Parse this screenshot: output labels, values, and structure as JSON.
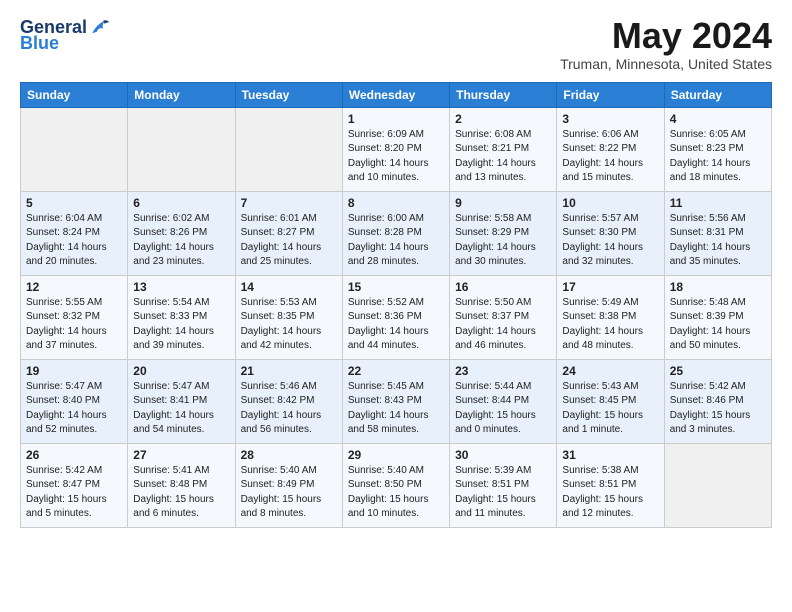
{
  "header": {
    "logo_general": "General",
    "logo_blue": "Blue",
    "month": "May 2024",
    "location": "Truman, Minnesota, United States"
  },
  "weekdays": [
    "Sunday",
    "Monday",
    "Tuesday",
    "Wednesday",
    "Thursday",
    "Friday",
    "Saturday"
  ],
  "weeks": [
    [
      {
        "day": "",
        "text": ""
      },
      {
        "day": "",
        "text": ""
      },
      {
        "day": "",
        "text": ""
      },
      {
        "day": "1",
        "text": "Sunrise: 6:09 AM\nSunset: 8:20 PM\nDaylight: 14 hours\nand 10 minutes."
      },
      {
        "day": "2",
        "text": "Sunrise: 6:08 AM\nSunset: 8:21 PM\nDaylight: 14 hours\nand 13 minutes."
      },
      {
        "day": "3",
        "text": "Sunrise: 6:06 AM\nSunset: 8:22 PM\nDaylight: 14 hours\nand 15 minutes."
      },
      {
        "day": "4",
        "text": "Sunrise: 6:05 AM\nSunset: 8:23 PM\nDaylight: 14 hours\nand 18 minutes."
      }
    ],
    [
      {
        "day": "5",
        "text": "Sunrise: 6:04 AM\nSunset: 8:24 PM\nDaylight: 14 hours\nand 20 minutes."
      },
      {
        "day": "6",
        "text": "Sunrise: 6:02 AM\nSunset: 8:26 PM\nDaylight: 14 hours\nand 23 minutes."
      },
      {
        "day": "7",
        "text": "Sunrise: 6:01 AM\nSunset: 8:27 PM\nDaylight: 14 hours\nand 25 minutes."
      },
      {
        "day": "8",
        "text": "Sunrise: 6:00 AM\nSunset: 8:28 PM\nDaylight: 14 hours\nand 28 minutes."
      },
      {
        "day": "9",
        "text": "Sunrise: 5:58 AM\nSunset: 8:29 PM\nDaylight: 14 hours\nand 30 minutes."
      },
      {
        "day": "10",
        "text": "Sunrise: 5:57 AM\nSunset: 8:30 PM\nDaylight: 14 hours\nand 32 minutes."
      },
      {
        "day": "11",
        "text": "Sunrise: 5:56 AM\nSunset: 8:31 PM\nDaylight: 14 hours\nand 35 minutes."
      }
    ],
    [
      {
        "day": "12",
        "text": "Sunrise: 5:55 AM\nSunset: 8:32 PM\nDaylight: 14 hours\nand 37 minutes."
      },
      {
        "day": "13",
        "text": "Sunrise: 5:54 AM\nSunset: 8:33 PM\nDaylight: 14 hours\nand 39 minutes."
      },
      {
        "day": "14",
        "text": "Sunrise: 5:53 AM\nSunset: 8:35 PM\nDaylight: 14 hours\nand 42 minutes."
      },
      {
        "day": "15",
        "text": "Sunrise: 5:52 AM\nSunset: 8:36 PM\nDaylight: 14 hours\nand 44 minutes."
      },
      {
        "day": "16",
        "text": "Sunrise: 5:50 AM\nSunset: 8:37 PM\nDaylight: 14 hours\nand 46 minutes."
      },
      {
        "day": "17",
        "text": "Sunrise: 5:49 AM\nSunset: 8:38 PM\nDaylight: 14 hours\nand 48 minutes."
      },
      {
        "day": "18",
        "text": "Sunrise: 5:48 AM\nSunset: 8:39 PM\nDaylight: 14 hours\nand 50 minutes."
      }
    ],
    [
      {
        "day": "19",
        "text": "Sunrise: 5:47 AM\nSunset: 8:40 PM\nDaylight: 14 hours\nand 52 minutes."
      },
      {
        "day": "20",
        "text": "Sunrise: 5:47 AM\nSunset: 8:41 PM\nDaylight: 14 hours\nand 54 minutes."
      },
      {
        "day": "21",
        "text": "Sunrise: 5:46 AM\nSunset: 8:42 PM\nDaylight: 14 hours\nand 56 minutes."
      },
      {
        "day": "22",
        "text": "Sunrise: 5:45 AM\nSunset: 8:43 PM\nDaylight: 14 hours\nand 58 minutes."
      },
      {
        "day": "23",
        "text": "Sunrise: 5:44 AM\nSunset: 8:44 PM\nDaylight: 15 hours\nand 0 minutes."
      },
      {
        "day": "24",
        "text": "Sunrise: 5:43 AM\nSunset: 8:45 PM\nDaylight: 15 hours\nand 1 minute."
      },
      {
        "day": "25",
        "text": "Sunrise: 5:42 AM\nSunset: 8:46 PM\nDaylight: 15 hours\nand 3 minutes."
      }
    ],
    [
      {
        "day": "26",
        "text": "Sunrise: 5:42 AM\nSunset: 8:47 PM\nDaylight: 15 hours\nand 5 minutes."
      },
      {
        "day": "27",
        "text": "Sunrise: 5:41 AM\nSunset: 8:48 PM\nDaylight: 15 hours\nand 6 minutes."
      },
      {
        "day": "28",
        "text": "Sunrise: 5:40 AM\nSunset: 8:49 PM\nDaylight: 15 hours\nand 8 minutes."
      },
      {
        "day": "29",
        "text": "Sunrise: 5:40 AM\nSunset: 8:50 PM\nDaylight: 15 hours\nand 10 minutes."
      },
      {
        "day": "30",
        "text": "Sunrise: 5:39 AM\nSunset: 8:51 PM\nDaylight: 15 hours\nand 11 minutes."
      },
      {
        "day": "31",
        "text": "Sunrise: 5:38 AM\nSunset: 8:51 PM\nDaylight: 15 hours\nand 12 minutes."
      },
      {
        "day": "",
        "text": ""
      }
    ]
  ]
}
